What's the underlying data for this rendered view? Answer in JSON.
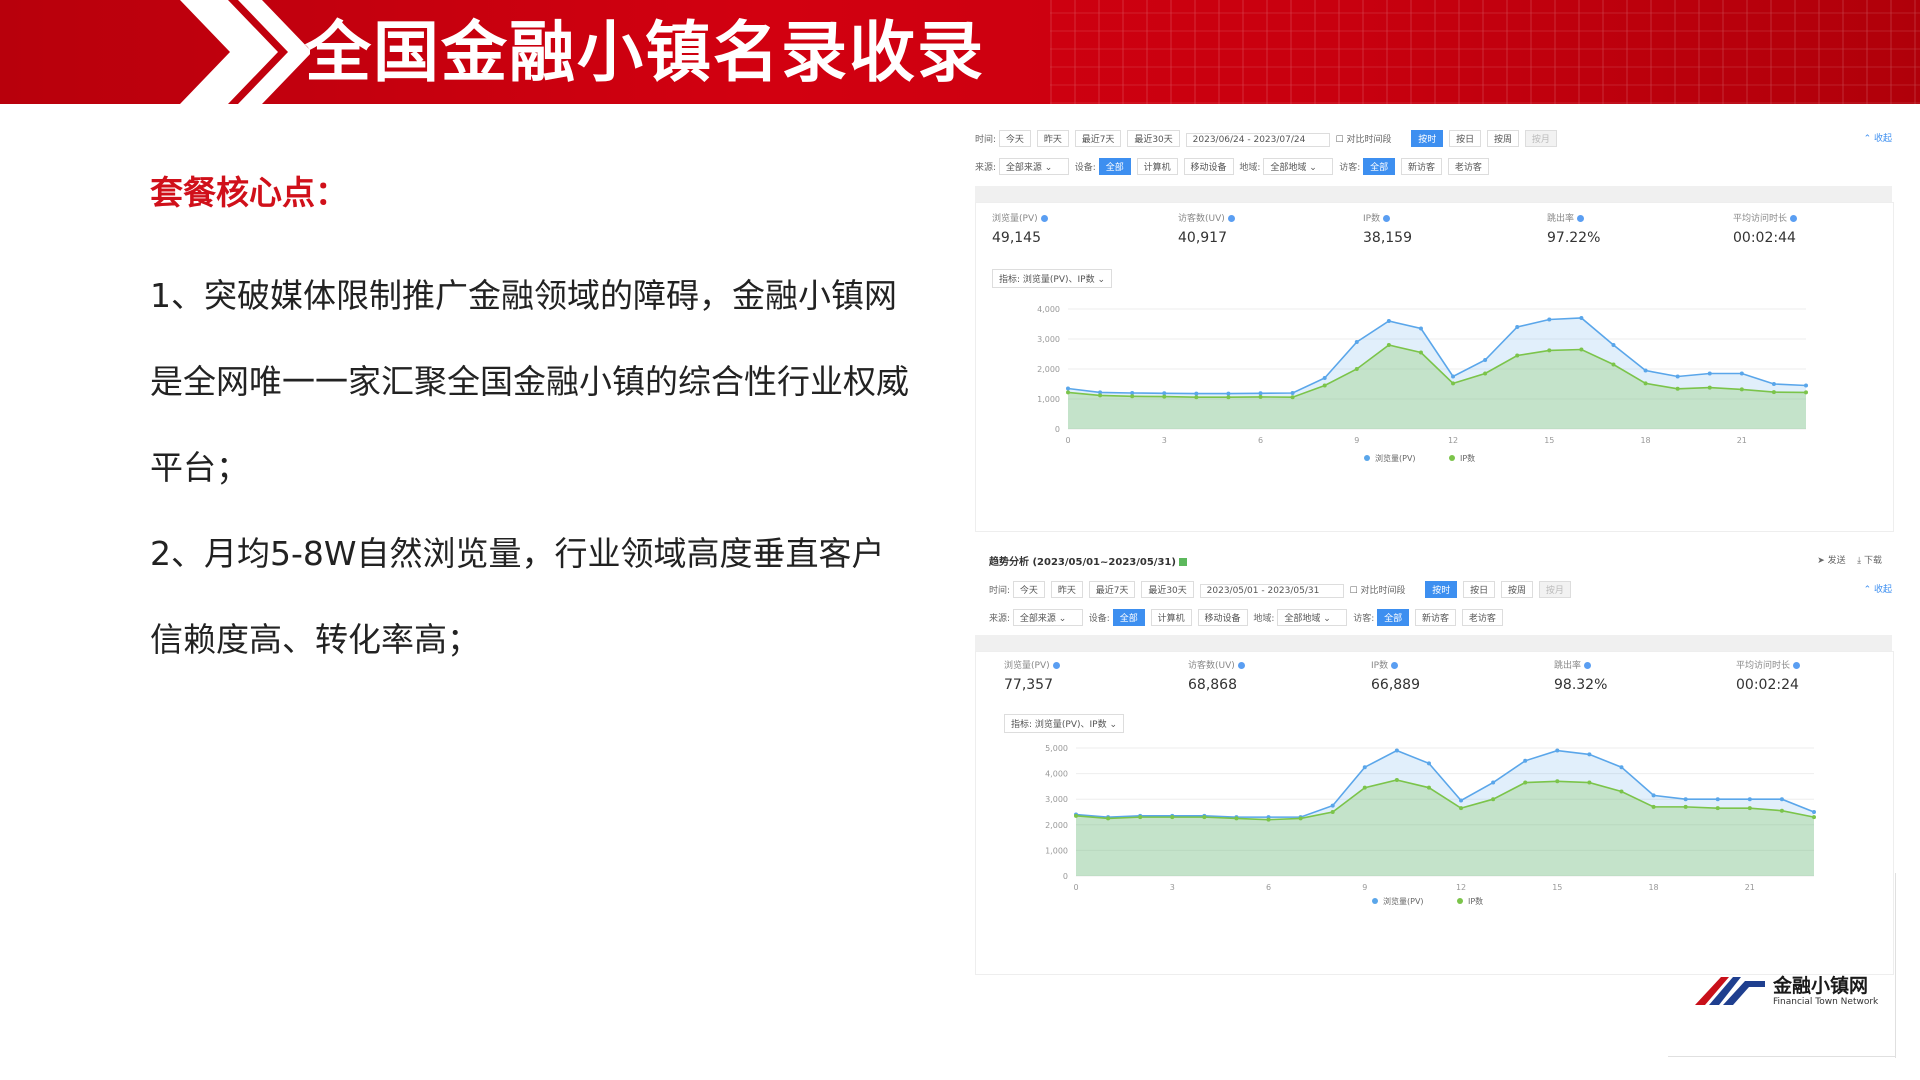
{
  "slide": {
    "title": "全国金融小镇名录收录",
    "core_heading": "套餐核心点：",
    "paragraphs": [
      "1、突破媒体限制推广金融领域的障碍，金融小镇网是全网唯一一家汇聚全国金融小镇的综合性行业权威平台；",
      "2、月均5-8W自然浏览量，行业领域高度垂直客户信赖度高、转化率高；"
    ]
  },
  "colors": {
    "header_red": "#c8000f",
    "core_red": "#d0101a",
    "pv_blue": "#5aa6ea",
    "ip_green": "#7bc44a",
    "active_blue": "#3d8ff0"
  },
  "panel1": {
    "toolbar_row1": {
      "label": "时间:",
      "chips": [
        "今天",
        "昨天",
        "最近7天",
        "最近30天"
      ],
      "date_range": "2023/06/24 - 2023/07/24",
      "compare": "对比时间段",
      "granularity": [
        "按时",
        "按日",
        "按周",
        "按月"
      ],
      "collapse": "收起"
    },
    "toolbar_row2": {
      "source_label": "来源:",
      "source_value": "全部来源",
      "device_label": "设备:",
      "devices": [
        "全部",
        "计算机",
        "移动设备"
      ],
      "region_label": "地域:",
      "region_value": "全部地域",
      "visitor_label": "访客:",
      "visitors": [
        "全部",
        "新访客",
        "老访客"
      ]
    },
    "metrics": [
      {
        "label": "浏览量(PV)",
        "value": "49,145"
      },
      {
        "label": "访客数(UV)",
        "value": "40,917"
      },
      {
        "label": "IP数",
        "value": "38,159"
      },
      {
        "label": "跳出率",
        "value": "97.22%"
      },
      {
        "label": "平均访问时长",
        "value": "00:02:44"
      }
    ],
    "indicator_label": "指标:",
    "indicator_value": "浏览量(PV)、IP数"
  },
  "panel2": {
    "section_title": "趋势分析 (2023/05/01~2023/05/31)",
    "actions": [
      "发送",
      "下载"
    ],
    "toolbar_row1": {
      "label": "时间:",
      "chips": [
        "今天",
        "昨天",
        "最近7天",
        "最近30天"
      ],
      "date_range": "2023/05/01 - 2023/05/31",
      "compare": "对比时间段",
      "granularity": [
        "按时",
        "按日",
        "按周",
        "按月"
      ],
      "collapse": "收起"
    },
    "toolbar_row2": {
      "source_label": "来源:",
      "source_value": "全部来源",
      "device_label": "设备:",
      "devices": [
        "全部",
        "计算机",
        "移动设备"
      ],
      "region_label": "地域:",
      "region_value": "全部地域",
      "visitor_label": "访客:",
      "visitors": [
        "全部",
        "新访客",
        "老访客"
      ]
    },
    "metrics": [
      {
        "label": "浏览量(PV)",
        "value": "77,357"
      },
      {
        "label": "访客数(UV)",
        "value": "68,868"
      },
      {
        "label": "IP数",
        "value": "66,889"
      },
      {
        "label": "跳出率",
        "value": "98.32%"
      },
      {
        "label": "平均访问时长",
        "value": "00:02:24"
      }
    ],
    "indicator_label": "指标:",
    "indicator_value": "浏览量(PV)、IP数"
  },
  "chart_data": [
    {
      "type": "area",
      "x": [
        0,
        1,
        2,
        3,
        4,
        5,
        6,
        7,
        8,
        9,
        10,
        11,
        12,
        13,
        14,
        15,
        16,
        17,
        18,
        19,
        20,
        21,
        22,
        23
      ],
      "xticks": [
        "0",
        "3",
        "6",
        "9",
        "12",
        "15",
        "18",
        "21"
      ],
      "yticks": [
        "0",
        "1,000",
        "2,000",
        "3,000",
        "4,000"
      ],
      "ylim": [
        0,
        4000
      ],
      "series": [
        {
          "name": "浏览量(PV)",
          "color": "#5aa6ea",
          "values": [
            1350,
            1220,
            1200,
            1190,
            1180,
            1180,
            1190,
            1200,
            1700,
            2900,
            3600,
            3350,
            1750,
            2300,
            3400,
            3650,
            3700,
            2800,
            1950,
            1750,
            1850,
            1850,
            1500,
            1450
          ]
        },
        {
          "name": "IP数",
          "color": "#7bc44a",
          "values": [
            1220,
            1120,
            1090,
            1080,
            1060,
            1060,
            1070,
            1060,
            1450,
            2000,
            2800,
            2550,
            1520,
            1850,
            2450,
            2620,
            2650,
            2150,
            1520,
            1340,
            1380,
            1320,
            1230,
            1220
          ]
        }
      ],
      "legend": "bottom"
    },
    {
      "type": "area",
      "x": [
        0,
        1,
        2,
        3,
        4,
        5,
        6,
        7,
        8,
        9,
        10,
        11,
        12,
        13,
        14,
        15,
        16,
        17,
        18,
        19,
        20,
        21,
        22,
        23
      ],
      "xticks": [
        "0",
        "3",
        "6",
        "9",
        "12",
        "15",
        "18",
        "21"
      ],
      "yticks": [
        "0",
        "1,000",
        "2,000",
        "3,000",
        "4,000",
        "5,000"
      ],
      "ylim": [
        0,
        5000
      ],
      "series": [
        {
          "name": "浏览量(PV)",
          "color": "#5aa6ea",
          "values": [
            2400,
            2300,
            2350,
            2350,
            2350,
            2300,
            2300,
            2300,
            2750,
            4250,
            4900,
            4400,
            2950,
            3650,
            4500,
            4900,
            4750,
            4250,
            3150,
            3000,
            3000,
            3000,
            3000,
            2500
          ]
        },
        {
          "name": "IP数",
          "color": "#7bc44a",
          "values": [
            2350,
            2250,
            2300,
            2300,
            2300,
            2250,
            2200,
            2250,
            2500,
            3450,
            3750,
            3450,
            2650,
            3000,
            3650,
            3700,
            3650,
            3300,
            2700,
            2700,
            2650,
            2650,
            2550,
            2300
          ]
        }
      ],
      "legend": "bottom"
    }
  ],
  "logo": {
    "name": "金融小镇网",
    "sub": "Financial Town Network"
  }
}
